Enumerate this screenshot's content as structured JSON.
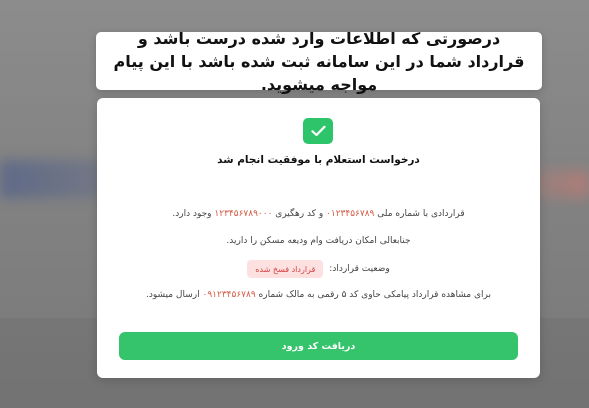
{
  "callout": {
    "text": "درصورتی که اطلاعات وارد شده درست باشد و قرارداد شما در این سامانه ثبت شده باشد با این پیام مواجه میشوید."
  },
  "card": {
    "icon": "check-icon",
    "title": "درخواست استعلام با موفقیت انجام شد",
    "line1": {
      "prefix": "قراردادی با شماره ملی",
      "national_id": "۰۱۲۳۴۵۶۷۸۹",
      "middle": "و کد رهگیری",
      "tracking_code": "۱۲۳۴۵۶۷۸۹۰۰۰",
      "suffix": "وجود دارد."
    },
    "line2": "جنابعالی امکان دریافت وام ودیعه مسکن را دارید.",
    "status": {
      "label": "وضعیت قرارداد:",
      "value": "قرارداد فسخ شده"
    },
    "line4": {
      "prefix": "برای مشاهده قرارداد پیامکی حاوی کد ۵ رقمی به مالک شماره",
      "phone": "۰۹۱۲۳۴۵۶۷۸۹",
      "suffix": "ارسال میشود."
    },
    "button_label": "دریافت کد ورود"
  },
  "colors": {
    "success": "#2ec46a",
    "button": "#35c46b",
    "highlight": "#d25b45",
    "badge_bg": "#fde1e1",
    "badge_text": "#d64040"
  }
}
